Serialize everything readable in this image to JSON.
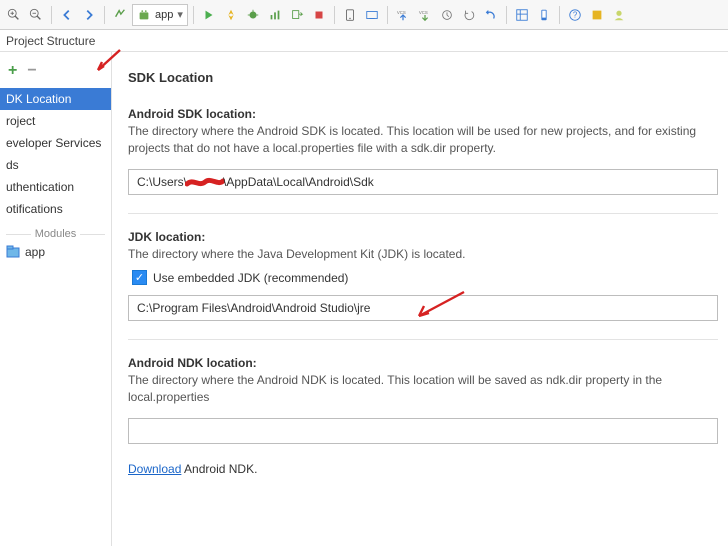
{
  "toolbar": {
    "dropdown_label": "app"
  },
  "window": {
    "title": "Project Structure"
  },
  "sidebar": {
    "items": [
      "DK Location",
      "roject",
      "eveloper Services",
      "ds",
      "uthentication",
      "otifications"
    ],
    "modules_label": "Modules",
    "module_name": "app"
  },
  "main": {
    "title": "SDK Location",
    "sdk": {
      "label": "Android SDK location:",
      "desc": "The directory where the Android SDK is located. This location will be used for new projects, and for existing projects that do not have a local.properties file with a sdk.dir property.",
      "value": "C:\\Users\\",
      "value2": "\\AppData\\Local\\Android\\Sdk"
    },
    "jdk": {
      "label": "JDK location:",
      "desc": "The directory where the Java Development Kit (JDK) is located.",
      "checkbox_label": "Use embedded JDK (recommended)",
      "value": "C:\\Program Files\\Android\\Android Studio\\jre"
    },
    "ndk": {
      "label": "Android NDK location:",
      "desc": "The directory where the Android NDK is located. This location will be saved as ndk.dir property in the local.properties",
      "value": "",
      "link_text": "Download",
      "link_suffix": " Android NDK."
    }
  }
}
